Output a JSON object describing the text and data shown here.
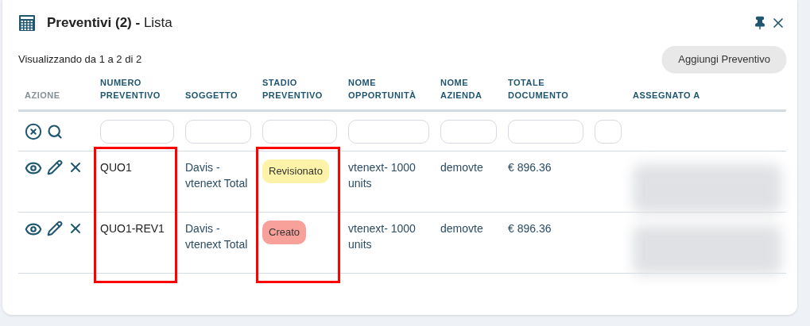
{
  "window": {
    "title": "**Preventivi (2) -** Lista"
  },
  "record_info": "Visualizzando da 1 a 2 di 2",
  "add_button": "Aggiungi Preventivo",
  "table": {
    "columns": [
      {
        "kind": "action",
        "label": "AZIONE"
      },
      {
        "kind": "data",
        "label": "NUMERO PREVENTIVO",
        "filter": true,
        "highlighted": true
      },
      {
        "kind": "data",
        "label": "SOGGETTO",
        "filter": true,
        "highlighted": false
      },
      {
        "kind": "data",
        "label": "STADIO PREVENTIVO",
        "filter": true,
        "highlighted": true
      },
      {
        "kind": "data",
        "label": "NOME OPPORTUNITÀ",
        "filter": true,
        "highlighted": false
      },
      {
        "kind": "data",
        "label": "NOME AZIENDA",
        "filter": true,
        "highlighted": false
      },
      {
        "kind": "data",
        "label": "TOTALE DOCUMENTO",
        "filter": true,
        "highlighted": false
      },
      {
        "kind": "filler",
        "filter": true
      },
      {
        "kind": "data",
        "label": "ASSEGNATO A",
        "filter": false,
        "highlighted": false
      }
    ],
    "rows": [
      {
        "cells": [
          {
            "kind": "actions"
          },
          {
            "kind": "text",
            "text": "QUO1"
          },
          {
            "kind": "text",
            "text": "Davis - vtenext Total"
          },
          {
            "kind": "badge",
            "text": "Revisionato",
            "color": "#fdf3a8"
          },
          {
            "kind": "text",
            "text": "vtenext- 1000 units"
          },
          {
            "kind": "text",
            "text": "demovte"
          },
          {
            "kind": "text",
            "text": "€ 896.36"
          },
          "",
          {
            "kind": "redacted"
          }
        ]
      },
      {
        "cells": [
          {
            "kind": "actions"
          },
          {
            "kind": "text",
            "text": "QUO1-REV1"
          },
          {
            "kind": "text",
            "text": "Davis - vtenext Total"
          },
          {
            "kind": "badge",
            "text": "Creato",
            "color": "#f8a09a"
          },
          {
            "kind": "text",
            "text": "vtenext- 1000 units"
          },
          {
            "kind": "text",
            "text": "demovte"
          },
          {
            "kind": "text",
            "text": "€ 896.36"
          },
          "",
          {
            "kind": "redacted"
          }
        ]
      }
    ]
  }
}
